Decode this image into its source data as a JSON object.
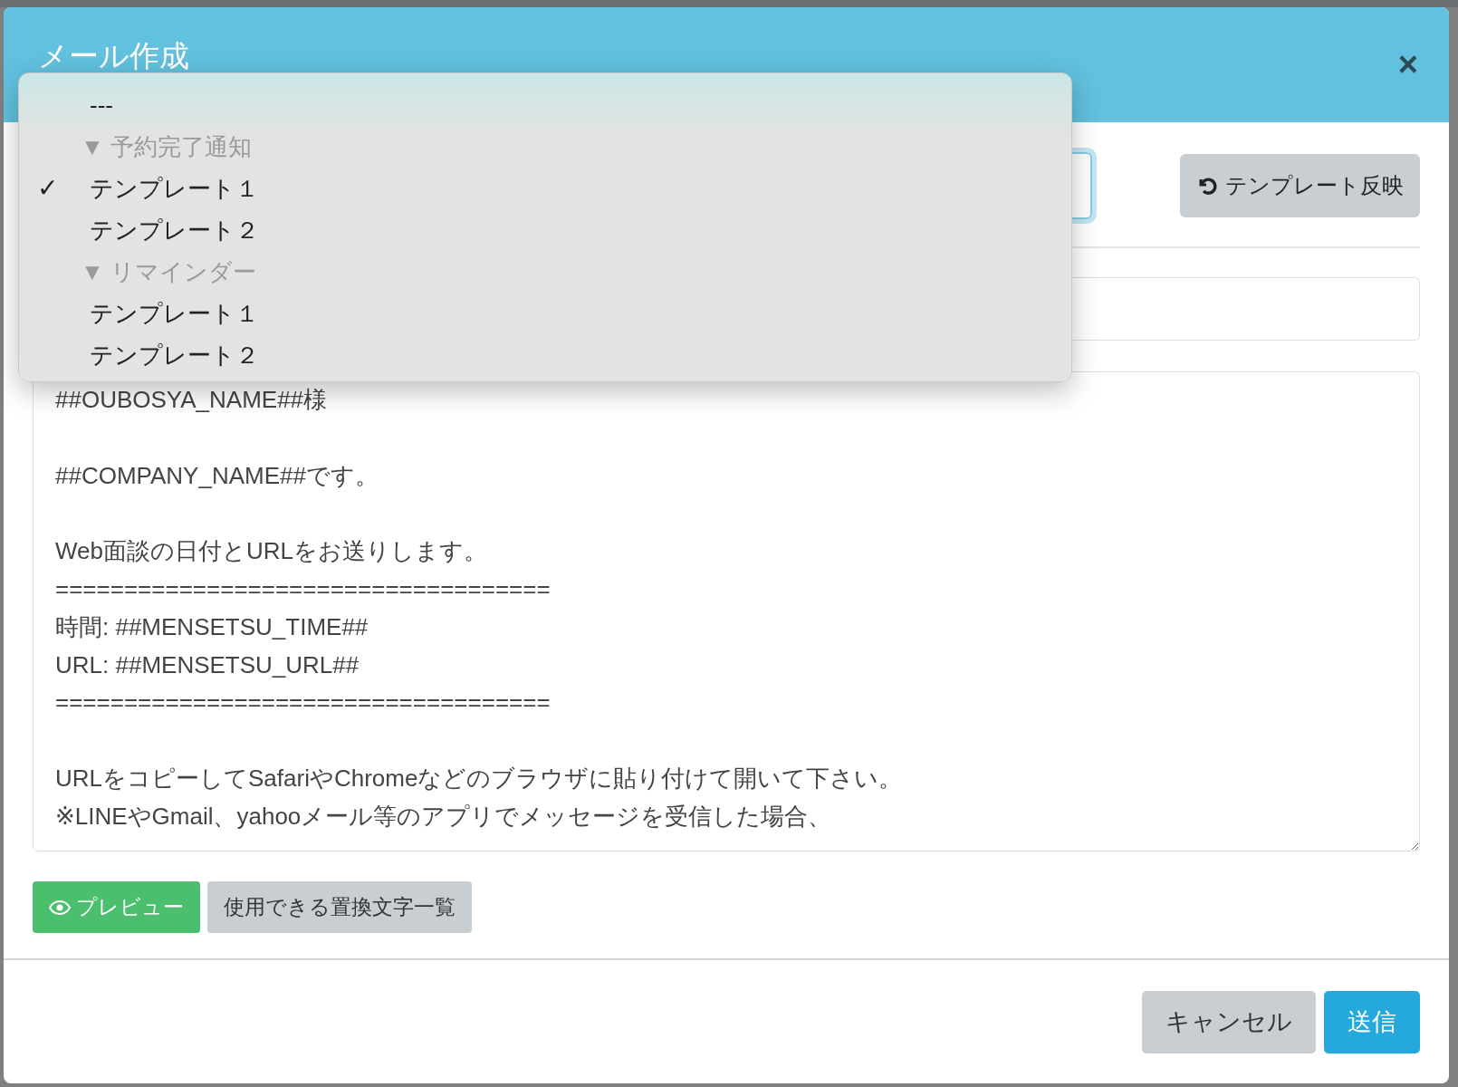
{
  "modal": {
    "title": "メール作成",
    "close": "×"
  },
  "template_select": {
    "menu": [
      {
        "kind": "option",
        "label": "---",
        "selected": false
      },
      {
        "kind": "group",
        "label": "予約完了通知",
        "marker": "▼",
        "children": [
          {
            "label": "テンプレート１",
            "selected": true
          },
          {
            "label": "テンプレート２",
            "selected": false
          }
        ]
      },
      {
        "kind": "group",
        "label": "リマインダー",
        "marker": "▼",
        "children": [
          {
            "label": "テンプレート１",
            "selected": false
          },
          {
            "label": "テンプレート２",
            "selected": false
          }
        ]
      }
    ],
    "check": "✓"
  },
  "apply_button": "テンプレート反映",
  "body": "##OUBOSYA_NAME##様\n\n##COMPANY_NAME##です。\n\nWeb面談の日付とURLをお送りします。\n====================================\n時間: ##MENSETSU_TIME##\nURL: ##MENSETSU_URL##\n====================================\n\nURLをコピーしてSafariやChromeなどのブラウザに貼り付けて開いて下さい。\n※LINEやGmail、yahooメール等のアプリでメッセージを受信した場合、",
  "tool_buttons": [
    {
      "kind": "preview",
      "label": "プレビュー"
    },
    {
      "kind": "plain",
      "label": "使用できる置換文字一覧"
    }
  ],
  "footer_buttons": [
    {
      "kind": "secondary",
      "label": "キャンセル"
    },
    {
      "kind": "primary",
      "label": "送信"
    }
  ]
}
